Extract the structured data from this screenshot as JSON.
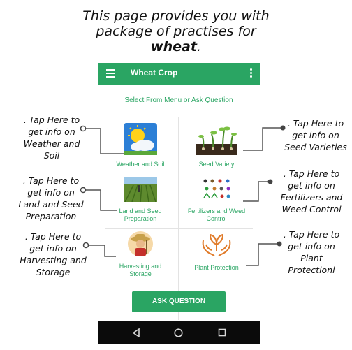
{
  "headline": {
    "line1": "This page provides you with",
    "line2": "package of practises for",
    "crop_word": "wheat",
    "crop_suffix": "."
  },
  "app": {
    "title": "Wheat Crop",
    "prompt": "Select From Menu or Ask Question",
    "tiles": [
      {
        "label_1": "Weather and Soil",
        "label_2": ""
      },
      {
        "label_1": "Seed Variety",
        "label_2": ""
      },
      {
        "label_1": "Land and Seed",
        "label_2": "Preparation"
      },
      {
        "label_1": "Fertilizers and Weed",
        "label_2": "Control"
      },
      {
        "label_1": "Harvesting and",
        "label_2": "Storage"
      },
      {
        "label_1": "Plant Protection",
        "label_2": ""
      }
    ],
    "ask_button": "ASK QUESTION",
    "accent_color": "#2aa563"
  },
  "callouts": {
    "weather": [
      ". Tap Here to",
      "get info on",
      "Weather and",
      "Soil"
    ],
    "seed": [
      ". Tap Here to",
      "get info on",
      "Seed Varieties"
    ],
    "land": [
      ". Tap Here to",
      "get info on",
      "Land and Seed",
      "Preparation"
    ],
    "fert": [
      ". Tap Here to",
      "get info on",
      "Fertilizers and",
      "Weed Control"
    ],
    "harvest": [
      ". Tap Here to",
      "get info on",
      "Harvesting and",
      "Storage"
    ],
    "plant": [
      ". Tap Here to",
      "get info on",
      "Plant",
      "Protectionl"
    ]
  },
  "icons": {
    "menu": "hamburger-menu-icon",
    "overflow": "kebab-menu-icon",
    "back": "back-triangle-icon",
    "home": "home-circle-icon",
    "recents": "recents-square-icon"
  }
}
